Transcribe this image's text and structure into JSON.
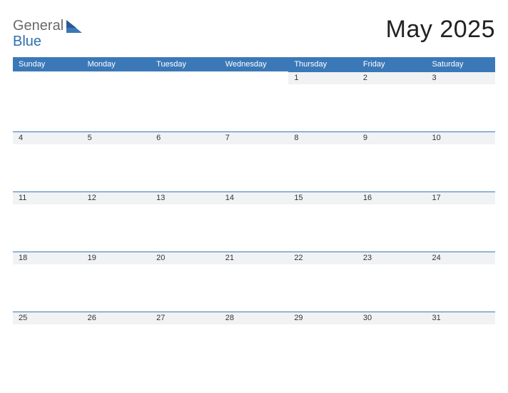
{
  "brand": {
    "word1": "General",
    "word2": "Blue"
  },
  "title": "May 2025",
  "colors": {
    "accent": "#3b78b8",
    "strip": "#f1f2f4"
  },
  "dow": [
    "Sunday",
    "Monday",
    "Tuesday",
    "Wednesday",
    "Thursday",
    "Friday",
    "Saturday"
  ],
  "weeks": [
    [
      "",
      "",
      "",
      "",
      "1",
      "2",
      "3"
    ],
    [
      "4",
      "5",
      "6",
      "7",
      "8",
      "9",
      "10"
    ],
    [
      "11",
      "12",
      "13",
      "14",
      "15",
      "16",
      "17"
    ],
    [
      "18",
      "19",
      "20",
      "21",
      "22",
      "23",
      "24"
    ],
    [
      "25",
      "26",
      "27",
      "28",
      "29",
      "30",
      "31"
    ]
  ]
}
